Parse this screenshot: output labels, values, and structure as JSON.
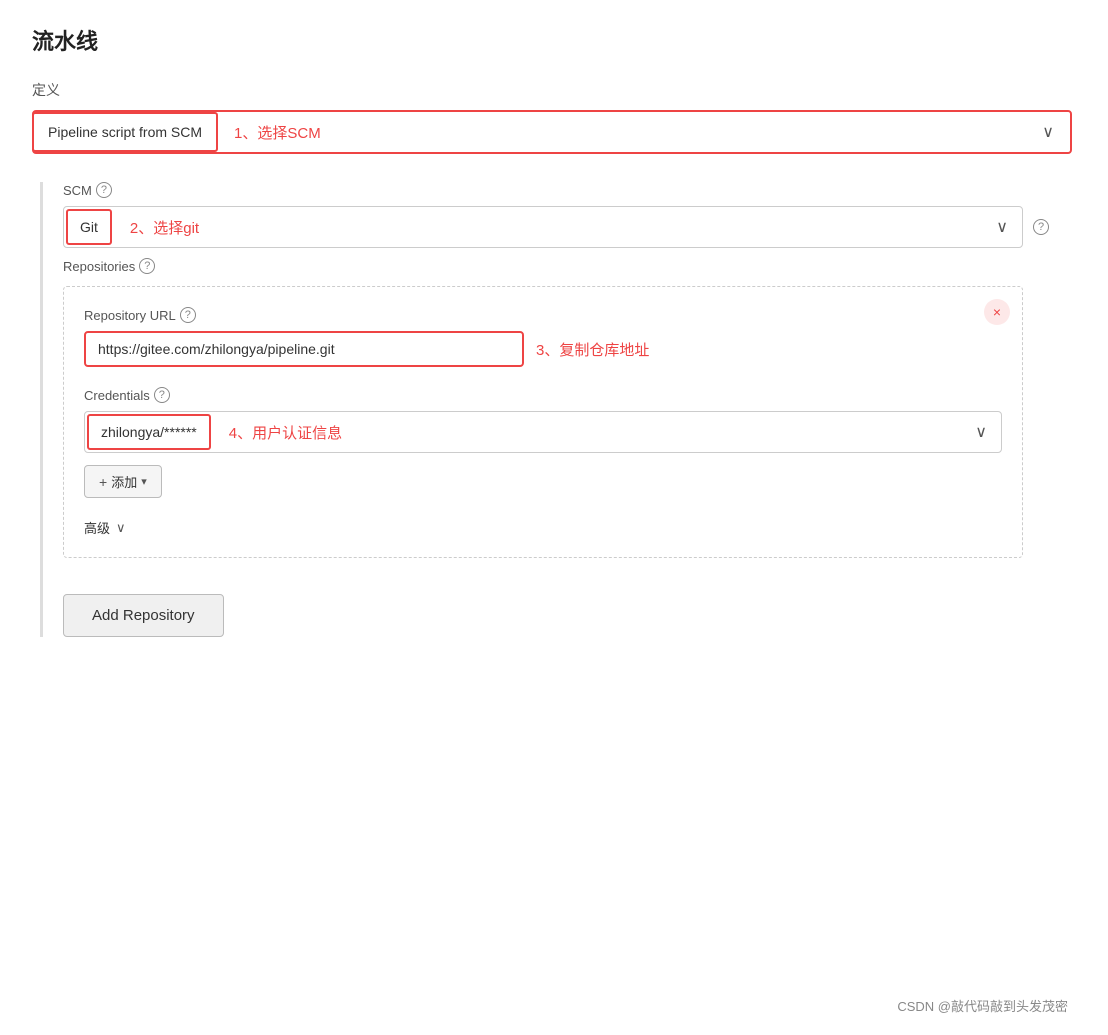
{
  "page": {
    "title": "流水线"
  },
  "definition": {
    "section_label": "定义",
    "selected_value": "Pipeline script from SCM",
    "annotation": "1、选择SCM",
    "dropdown_arrow": "∨"
  },
  "scm": {
    "label": "SCM",
    "help": "?",
    "selected_value": "Git",
    "annotation": "2、选择git",
    "dropdown_arrow": "∨",
    "help2": "?"
  },
  "repositories": {
    "label": "Repositories",
    "help": "?",
    "repo_url_label": "Repository URL",
    "repo_url_help": "?",
    "repo_url_value": "https://gitee.com/zhilongya/pipeline.git",
    "repo_url_annotation": "3、复制仓库地址",
    "credentials_label": "Credentials",
    "credentials_help": "?",
    "credentials_value": "zhilongya/******",
    "credentials_annotation": "4、用户认证信息",
    "credentials_arrow": "∨",
    "add_btn_label": "添加",
    "add_btn_prefix": "+",
    "advanced_label": "高级",
    "advanced_arrow": "∨",
    "close_btn": "×"
  },
  "add_repository_btn": "Add Repository",
  "footer": "CSDN @敲代码敲到头发茂密"
}
